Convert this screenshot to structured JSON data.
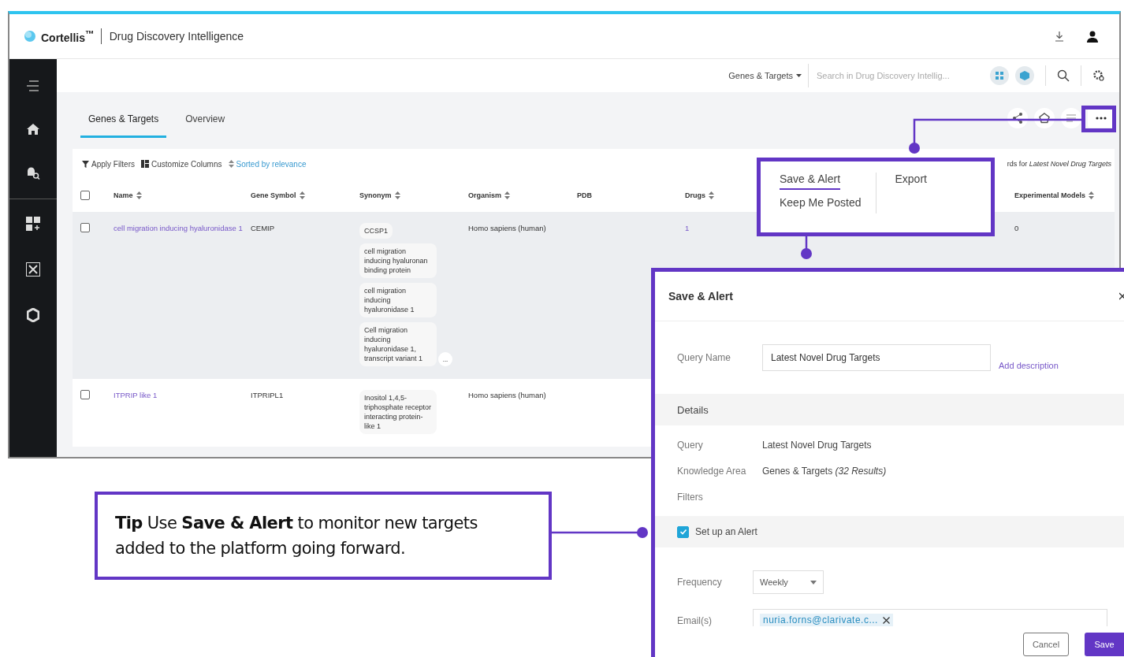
{
  "app": {
    "logo": "Cortellis$^{™}$",
    "product": "Drug Discovery Intelligence"
  },
  "search_bar": {
    "scope": "Genes & Targets",
    "placeholder": "Search in Drug Discovery Intellig..."
  },
  "tabs": [
    {
      "label": "Genes & Targets",
      "selected": true
    },
    {
      "label": "Overview",
      "selected": false
    }
  ],
  "toolbar": {
    "filters": "Apply Filters",
    "columns": "Customize Columns",
    "sort": "Sorted by relevance",
    "query_note": "rds for *Latest Novel Drug Targets*"
  },
  "table": {
    "all_checked": false,
    "columns": [
      {
        "label": "Name",
        "sortable": true
      },
      {
        "label": "Gene Symbol",
        "sortable": true
      },
      {
        "label": "Synonym",
        "sortable": true
      },
      {
        "label": "Organism",
        "sortable": true
      },
      {
        "label": "PDB",
        "sortable": false
      },
      {
        "label": "Drugs",
        "sortable": true
      },
      {
        "label": "Experimental Models",
        "sortable": true
      }
    ],
    "rows": [
      {
        "checked": false,
        "name": "cell migration inducing hyaluronidase 1",
        "symbol": "CEMIP",
        "synonyms": [
          "CCSP1",
          "cell migration inducing hyaluronan binding protein",
          "cell migration inducing hyaluronidase 1",
          "Cell migration inducing hyaluronidase 1, transcript variant 1"
        ],
        "more": "...",
        "organism": "Homo sapiens (human)",
        "drugs": "1",
        "experimental_models": "0"
      },
      {
        "checked": false,
        "name": "ITPRIP like 1",
        "symbol": "ITPRIPL1",
        "synonyms": [
          "Inositol 1,4,5-triphosphate receptor interacting protein-like 1"
        ],
        "organism": "Homo sapiens (human)"
      }
    ]
  },
  "menu": {
    "items": [
      {
        "label": "Save & Alert",
        "selected": true
      },
      {
        "label": "Keep Me Posted",
        "selected": false
      }
    ],
    "export": "Export"
  },
  "modal": {
    "title": "Save & Alert",
    "query_name_label": "Query Name",
    "query_name": "Latest Novel Drug Targets",
    "add_description": "Add description",
    "details_heading": "Details",
    "details": [
      {
        "label": "Query",
        "value": "Latest Novel Drug Targets"
      },
      {
        "label": "Knowledge Area",
        "value": "Genes & Targets *(32 Results)*"
      },
      {
        "label": "Filters"
      }
    ],
    "alert": {
      "label": "Set up an Alert",
      "checked": true
    },
    "frequency_label": "Frequency",
    "frequency": "Weekly",
    "emails_label": "Email(s)",
    "emails": [
      "nuria.forns@clarivate.c..."
    ],
    "cancel": "Cancel",
    "save": "Save"
  },
  "tip": {
    "text": "**Tip** Use **Save & Alert** to monitor new targets added to the platform going forward."
  }
}
